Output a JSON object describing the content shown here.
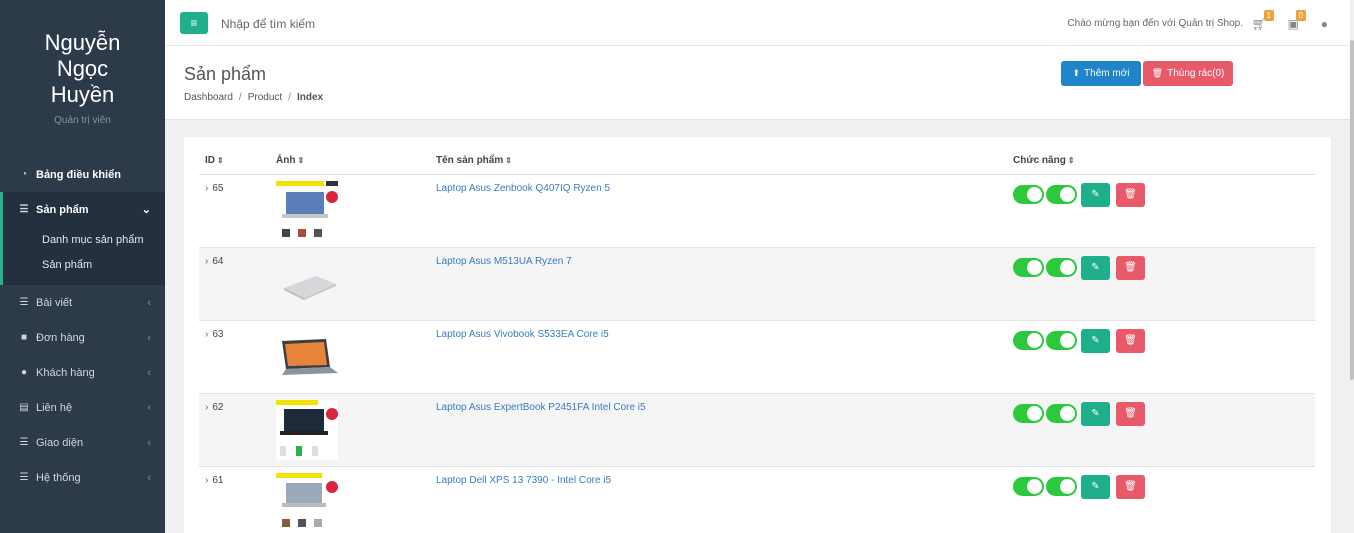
{
  "sidebar": {
    "profile_name": "Nguyễn Ngọc Huyền",
    "profile_role": "Quản trị viên",
    "items": [
      {
        "label": "Bảng điều khiển",
        "icon": "dashboard-icon"
      },
      {
        "label": "Sản phẩm",
        "icon": "list-icon"
      },
      {
        "label": "Bài viết",
        "icon": "list-icon"
      },
      {
        "label": "Đơn hàng",
        "icon": "shopping-bag-icon"
      },
      {
        "label": "Khách hàng",
        "icon": "users-icon"
      },
      {
        "label": "Liên hệ",
        "icon": "contact-card-icon"
      },
      {
        "label": "Giao diện",
        "icon": "list-icon"
      },
      {
        "label": "Hệ thống",
        "icon": "list-icon"
      }
    ],
    "subitems": [
      "Danh mục sản phẩm",
      "Sản phẩm"
    ]
  },
  "topbar": {
    "search_placeholder": "Nhập để tìm kiếm",
    "welcome": "Chào mừng bạn đến với Quản trị Shop.",
    "cart_count": "1",
    "message_count": "0"
  },
  "header": {
    "title": "Sản phẩm",
    "breadcrumb": [
      "Dashboard",
      "Product",
      "Index"
    ],
    "add_label": "Thêm mới",
    "trash_label": "Thùng rác(0)"
  },
  "table": {
    "columns": [
      "ID",
      "Ảnh",
      "Tên sản phẩm",
      "Chức năng"
    ],
    "rows": [
      {
        "id": "65",
        "name": "Laptop Asus Zenbook Q407IQ Ryzen 5"
      },
      {
        "id": "64",
        "name": "Laptop Asus M513UA Ryzen 7"
      },
      {
        "id": "63",
        "name": "Laptop Asus Vivobook S533EA Core i5"
      },
      {
        "id": "62",
        "name": "Laptop Asus ExpertBook P2451FA Intel Core i5"
      },
      {
        "id": "61",
        "name": "Laptop Dell XPS 13 7390 - Intel Core i5"
      }
    ]
  },
  "colors": {
    "sidebar_bg": "#2d3a4a",
    "accent": "#1faf8a",
    "primary": "#1f84c8",
    "danger": "#e85a6a",
    "toggle_on": "#2cc93c",
    "link": "#3c7bbf"
  }
}
